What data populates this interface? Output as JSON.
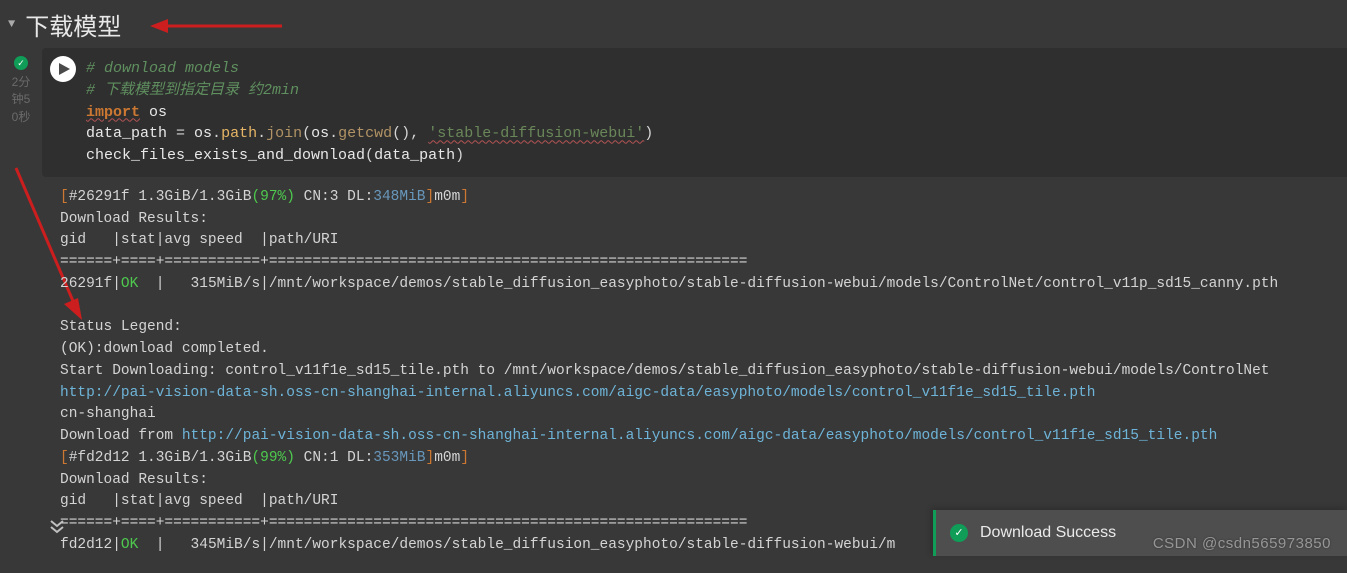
{
  "header": {
    "title": "下载模型"
  },
  "gutter": {
    "time1": "2分",
    "time2": "钟5",
    "time3": "0秒"
  },
  "code": {
    "line1": "# download models",
    "line2": "# 下载模型到指定目录 约2min",
    "kw_import": "import",
    "mod_os": " os",
    "var_dp": "data_path ",
    "eq": "= ",
    "os1": "os",
    "dot1": ".",
    "path_attr": "path",
    "dot2": ".",
    "join_fn": "join",
    "lp": "(",
    "os2": "os",
    "dot3": ".",
    "getcwd_fn": "getcwd",
    "paren_empty": "()",
    "comma_sp": ", ",
    "str_sdw": "'stable-diffusion-webui'",
    "rp": ")",
    "check_fn": "check_files_exists_and_download",
    "lp2": "(",
    "arg_dp": "data_path",
    "rp2": ")"
  },
  "output": {
    "l1a": "[",
    "l1b": "#26291f 1.3GiB/1.3GiB",
    "l1c": "(97%)",
    "l1d": " CN:3 DL:",
    "l1e": "348MiB",
    "l1f": "]",
    "l1g": "m0m",
    "l1h": "]",
    "l2": "Download Results:",
    "l3": "gid   |stat|avg speed  |path/URI",
    "l4": "======+====+===========+=======================================================",
    "l5a": "26291f|",
    "l5b": "OK",
    "l5c": "  |   315MiB/s|/mnt/workspace/demos/stable_diffusion_easyphoto/stable-diffusion-webui/models/ControlNet/control_v11p_sd15_canny.pth",
    "blank": " ",
    "l6": "Status Legend:",
    "l7": "(OK):download completed.",
    "l8": "Start Downloading: control_v11f1e_sd15_tile.pth to /mnt/workspace/demos/stable_diffusion_easyphoto/stable-diffusion-webui/models/ControlNet",
    "l9": "http://pai-vision-data-sh.oss-cn-shanghai-internal.aliyuncs.com/aigc-data/easyphoto/models/control_v11f1e_sd15_tile.pth",
    "l10": "cn-shanghai",
    "l11a": "Download from ",
    "l11b": "http://pai-vision-data-sh.oss-cn-shanghai-internal.aliyuncs.com/aigc-data/easyphoto/models/control_v11f1e_sd15_tile.pth",
    "l12a": "[",
    "l12b": "#fd2d12 1.3GiB/1.3GiB",
    "l12c": "(99%)",
    "l12d": " CN:1 DL:",
    "l12e": "353MiB",
    "l12f": "]",
    "l12g": "m0m",
    "l12h": "]",
    "l13": "Download Results:",
    "l14": "gid   |stat|avg speed  |path/URI",
    "l15": "======+====+===========+=======================================================",
    "l16a": "fd2d12|",
    "l16b": "OK",
    "l16c": "  |   345MiB/s|/mnt/workspace/demos/stable_diffusion_easyphoto/stable-diffusion-webui/m"
  },
  "toast": {
    "message": "Download Success"
  },
  "watermark": "CSDN @csdn565973850"
}
